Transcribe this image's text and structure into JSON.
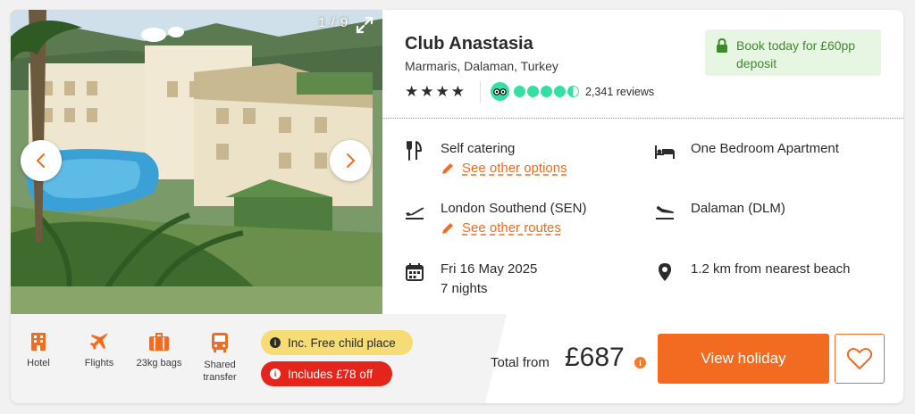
{
  "hotel": {
    "name": "Club Anastasia",
    "location": "Marmaris, Dalaman, Turkey",
    "star_rating": 4,
    "tripadvisor_rating": 4.5,
    "reviews": "2,341 reviews"
  },
  "gallery": {
    "counter": "1 / 9"
  },
  "deposit": {
    "text": "Book today for £60pp deposit"
  },
  "details": {
    "board": "Self catering",
    "board_link": "See other options",
    "room": "One Bedroom Apartment",
    "departure_airport": "London Southend (SEN)",
    "routes_link": "See other routes",
    "arrival_airport": "Dalaman (DLM)",
    "date": "Fri 16 May 2025",
    "nights": "7 nights",
    "beach": "1.2 km from nearest beach"
  },
  "inclusions": [
    {
      "label": "Hotel",
      "icon": "hotel-icon"
    },
    {
      "label": "Flights",
      "icon": "plane-icon"
    },
    {
      "label": "23kg bags",
      "icon": "suitcase-icon"
    },
    {
      "label": "Shared transfer",
      "icon": "bus-icon"
    }
  ],
  "badges": {
    "child_place": "Inc. Free child place",
    "discount": "Includes £78 off"
  },
  "price": {
    "label": "Total from",
    "amount": "£687"
  },
  "actions": {
    "view": "View holiday"
  },
  "colors": {
    "accent": "#f26b21",
    "deposit_bg": "#e7f6e3",
    "deposit_text": "#3d8a2c",
    "tripadvisor": "#34e0a1",
    "badge_yellow": "#f6dc74",
    "badge_red": "#e5241c"
  }
}
